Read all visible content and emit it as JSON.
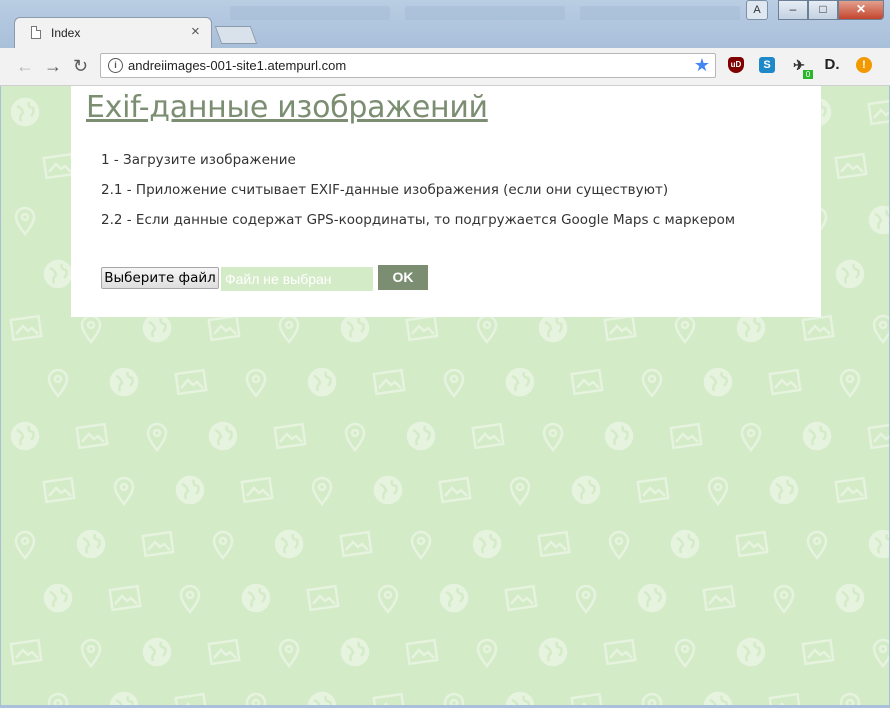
{
  "window": {
    "user_button": "A",
    "minimize": "–",
    "maximize": "□",
    "close": "✕"
  },
  "tab": {
    "title": "Index",
    "close": "×"
  },
  "toolbar": {
    "back": "←",
    "forward": "→",
    "reload": "↻",
    "url": "andreiimages-001-site1.atempurl.com",
    "star": "★",
    "extensions": {
      "ublock": "uD",
      "s": "S",
      "plane": "✈",
      "plane_badge": "0",
      "d": "D.",
      "warn": "!"
    }
  },
  "page": {
    "title": "Exif-данные изображений",
    "steps": [
      "1 - Загрузите изображение",
      "2.1 - Приложение считывает EXIF-данные изображения (если они существуют)",
      "2.2 - Если данные содержат GPS-координаты, то подгружается Google Maps с маркером"
    ],
    "file_button": "Выберите файл",
    "file_status": "Файл не выбран",
    "ok_button": "OK"
  },
  "colors": {
    "background": "#d4ebc8",
    "accent": "#7c8e72",
    "pattern_icon": "#e6f3de"
  }
}
